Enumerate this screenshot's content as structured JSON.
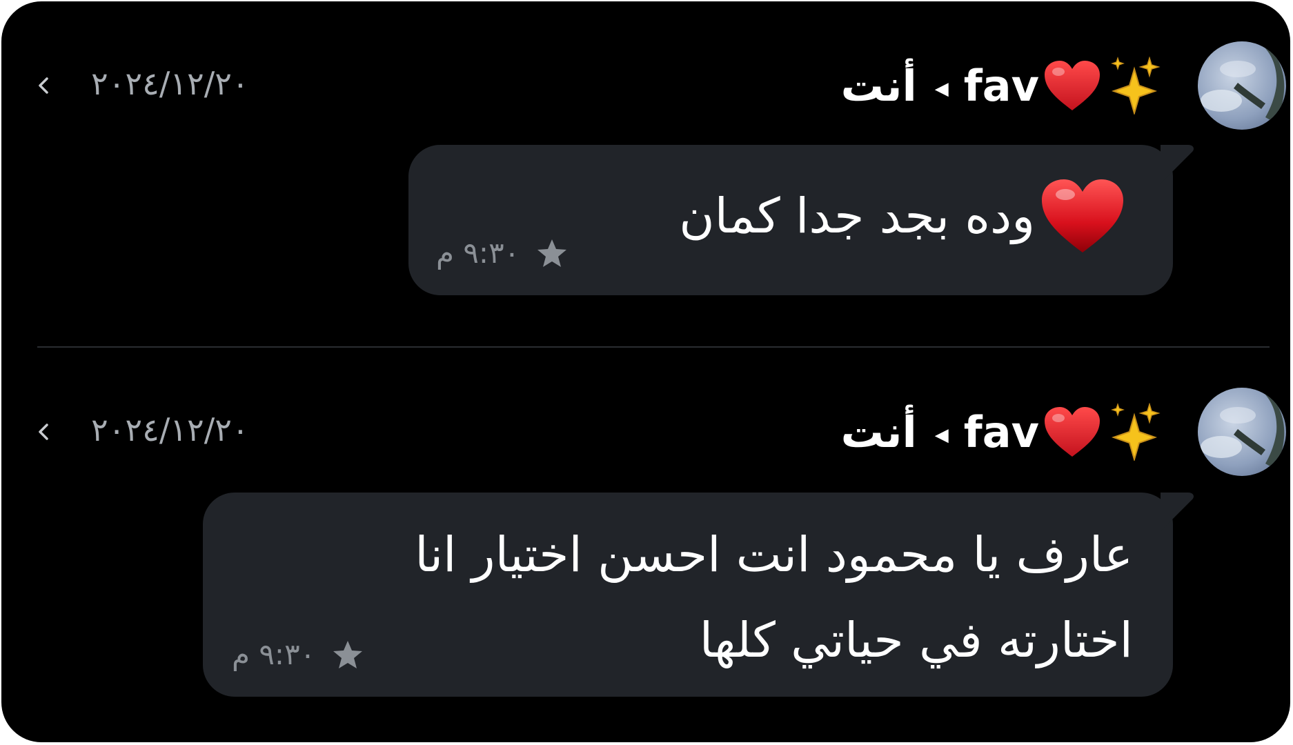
{
  "conversation": {
    "messages": [
      {
        "sender_name": "fav",
        "sender_decoration": [
          "sparkles-icon",
          "red-heart-icon"
        ],
        "recipient": "أنت",
        "date": "٢٠٢٤/١٢/٢٠",
        "body": "وده بجد جدا كمان",
        "body_emoji": "red-heart-icon",
        "time": "٩:٣٠ م",
        "starred": true
      },
      {
        "sender_name": "fav",
        "sender_decoration": [
          "sparkles-icon",
          "red-heart-icon"
        ],
        "recipient": "أنت",
        "date": "٢٠٢٤/١٢/٢٠",
        "body_lines": [
          "عارف يا محمود انت احسن اختيار انا",
          "اختارته في حياتي كلها"
        ],
        "time": "٩:٣٠ م",
        "starred": true
      }
    ]
  },
  "colors": {
    "background": "#000000",
    "bubble": "#212429",
    "text": "#ffffff",
    "meta": "#8b9096",
    "date": "#a8adb3",
    "heart": "#e0202c",
    "sparkle": "#f6c21c"
  }
}
